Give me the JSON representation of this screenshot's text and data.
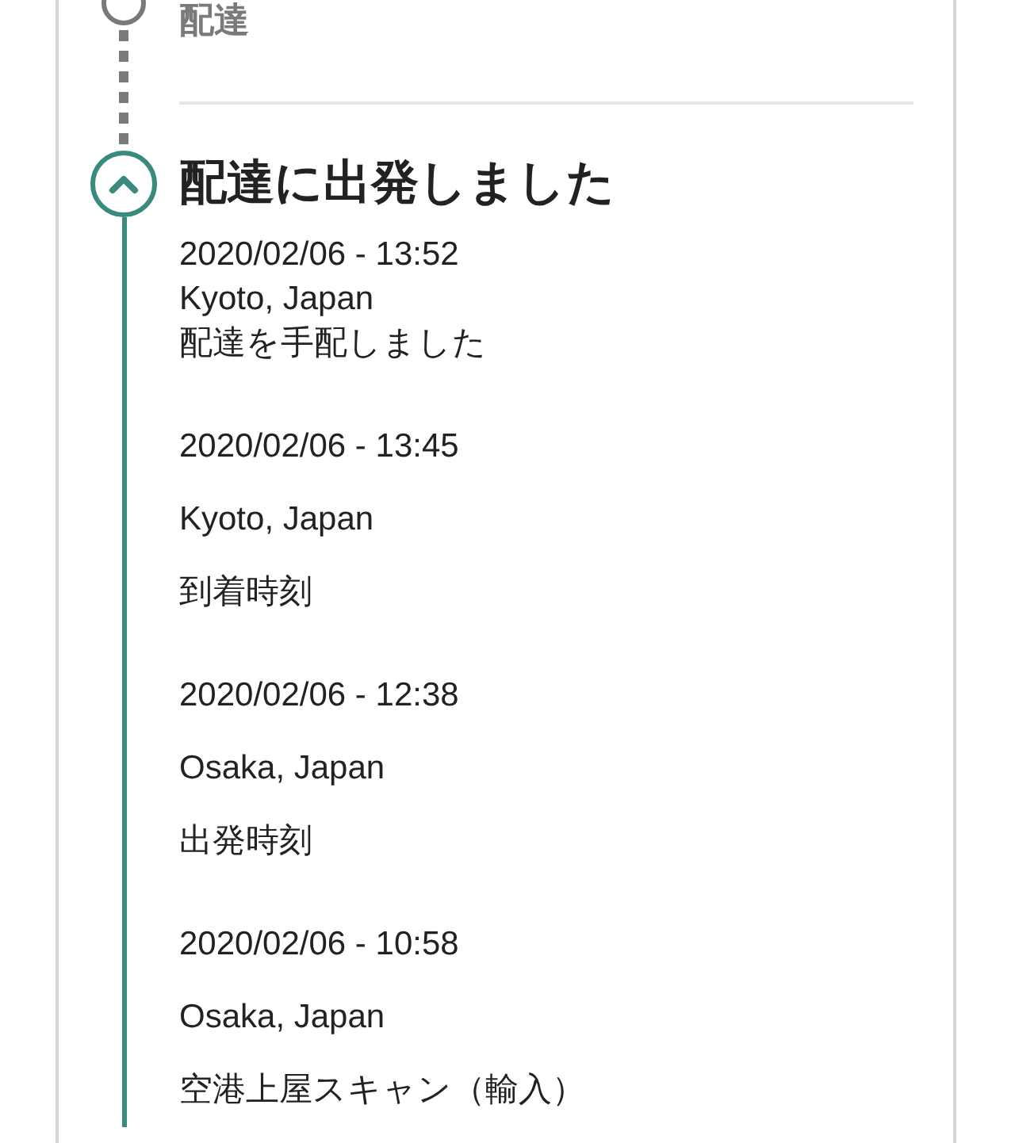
{
  "previous_step": {
    "label": "配達",
    "current": false
  },
  "current_step": {
    "title": "配達に出発しました",
    "current": true,
    "expanded": true
  },
  "events": [
    {
      "time": "2020/02/06 - 13:52",
      "location": "Kyoto, Japan",
      "description": "配達を手配しました",
      "compact": true
    },
    {
      "time": "2020/02/06 - 13:45",
      "location": "Kyoto, Japan",
      "description": "到着時刻",
      "compact": false
    },
    {
      "time": "2020/02/06 - 12:38",
      "location": "Osaka, Japan",
      "description": "出発時刻",
      "compact": false
    },
    {
      "time": "2020/02/06 - 10:58",
      "location": "Osaka, Japan",
      "description": "空港上屋スキャン（輸入）",
      "compact": false
    }
  ]
}
